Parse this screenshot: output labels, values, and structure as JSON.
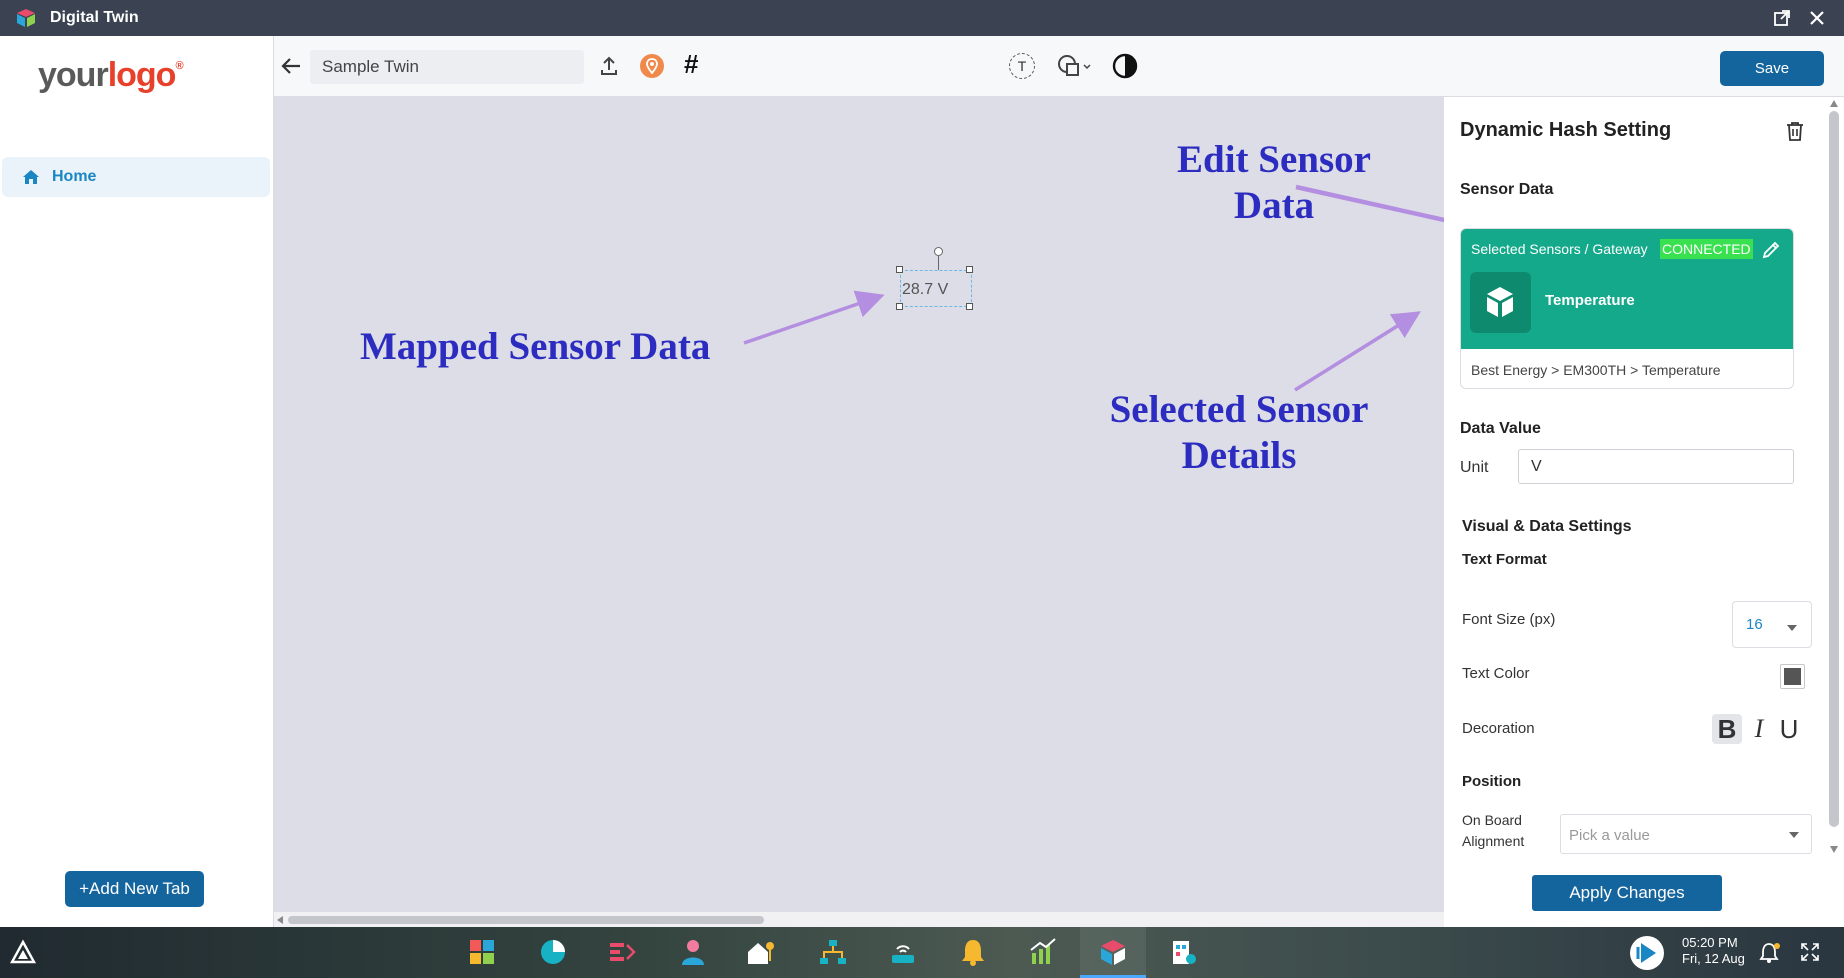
{
  "window": {
    "title": "Digital Twin"
  },
  "sidebar": {
    "logo_your": "your",
    "logo_logo": "logo",
    "logo_reg": "®",
    "nav_home": "Home",
    "add_tab": "+Add New Tab"
  },
  "toolbar": {
    "twin_name": "Sample Twin",
    "hash_symbol": "#",
    "text_tool_letter": "T",
    "save_label": "Save"
  },
  "canvas": {
    "widget_value": "28.7 V",
    "annotations": {
      "mapped": "Mapped Sensor Data",
      "edit_line1": "Edit Sensor",
      "edit_line2": "Data",
      "selected_line1": "Selected Sensor",
      "selected_line2": "Details"
    }
  },
  "panel": {
    "title": "Dynamic Hash Setting",
    "sensor_data_heading": "Sensor Data",
    "card": {
      "crumb": "Selected Sensors / Gateway",
      "status": "CONNECTED",
      "sensor_name": "Temperature",
      "path": "Best Energy > EM300TH > Temperature"
    },
    "data_value_heading": "Data Value",
    "unit_label": "Unit",
    "unit_value": "V",
    "visual_heading": "Visual & Data Settings",
    "text_format_heading": "Text Format",
    "font_size_label": "Font Size (px)",
    "font_size_value": "16",
    "text_color_label": "Text Color",
    "decoration_label": "Decoration",
    "bold": "B",
    "italic": "I",
    "underline": "U",
    "position_heading": "Position",
    "alignment_label_1": "On Board",
    "alignment_label_2": "Alignment",
    "alignment_placeholder": "Pick a value",
    "apply_label": "Apply Changes"
  },
  "taskbar": {
    "time": "05:20 PM",
    "date": "Fri, 12 Aug"
  },
  "colors": {
    "primary": "#14649e",
    "accent_teal": "#14a98a",
    "connected_green": "#39e050",
    "annotation_text": "#2c2cc0",
    "annotation_arrow": "#b48ee0",
    "canvas_bg": "#dcdde6"
  }
}
